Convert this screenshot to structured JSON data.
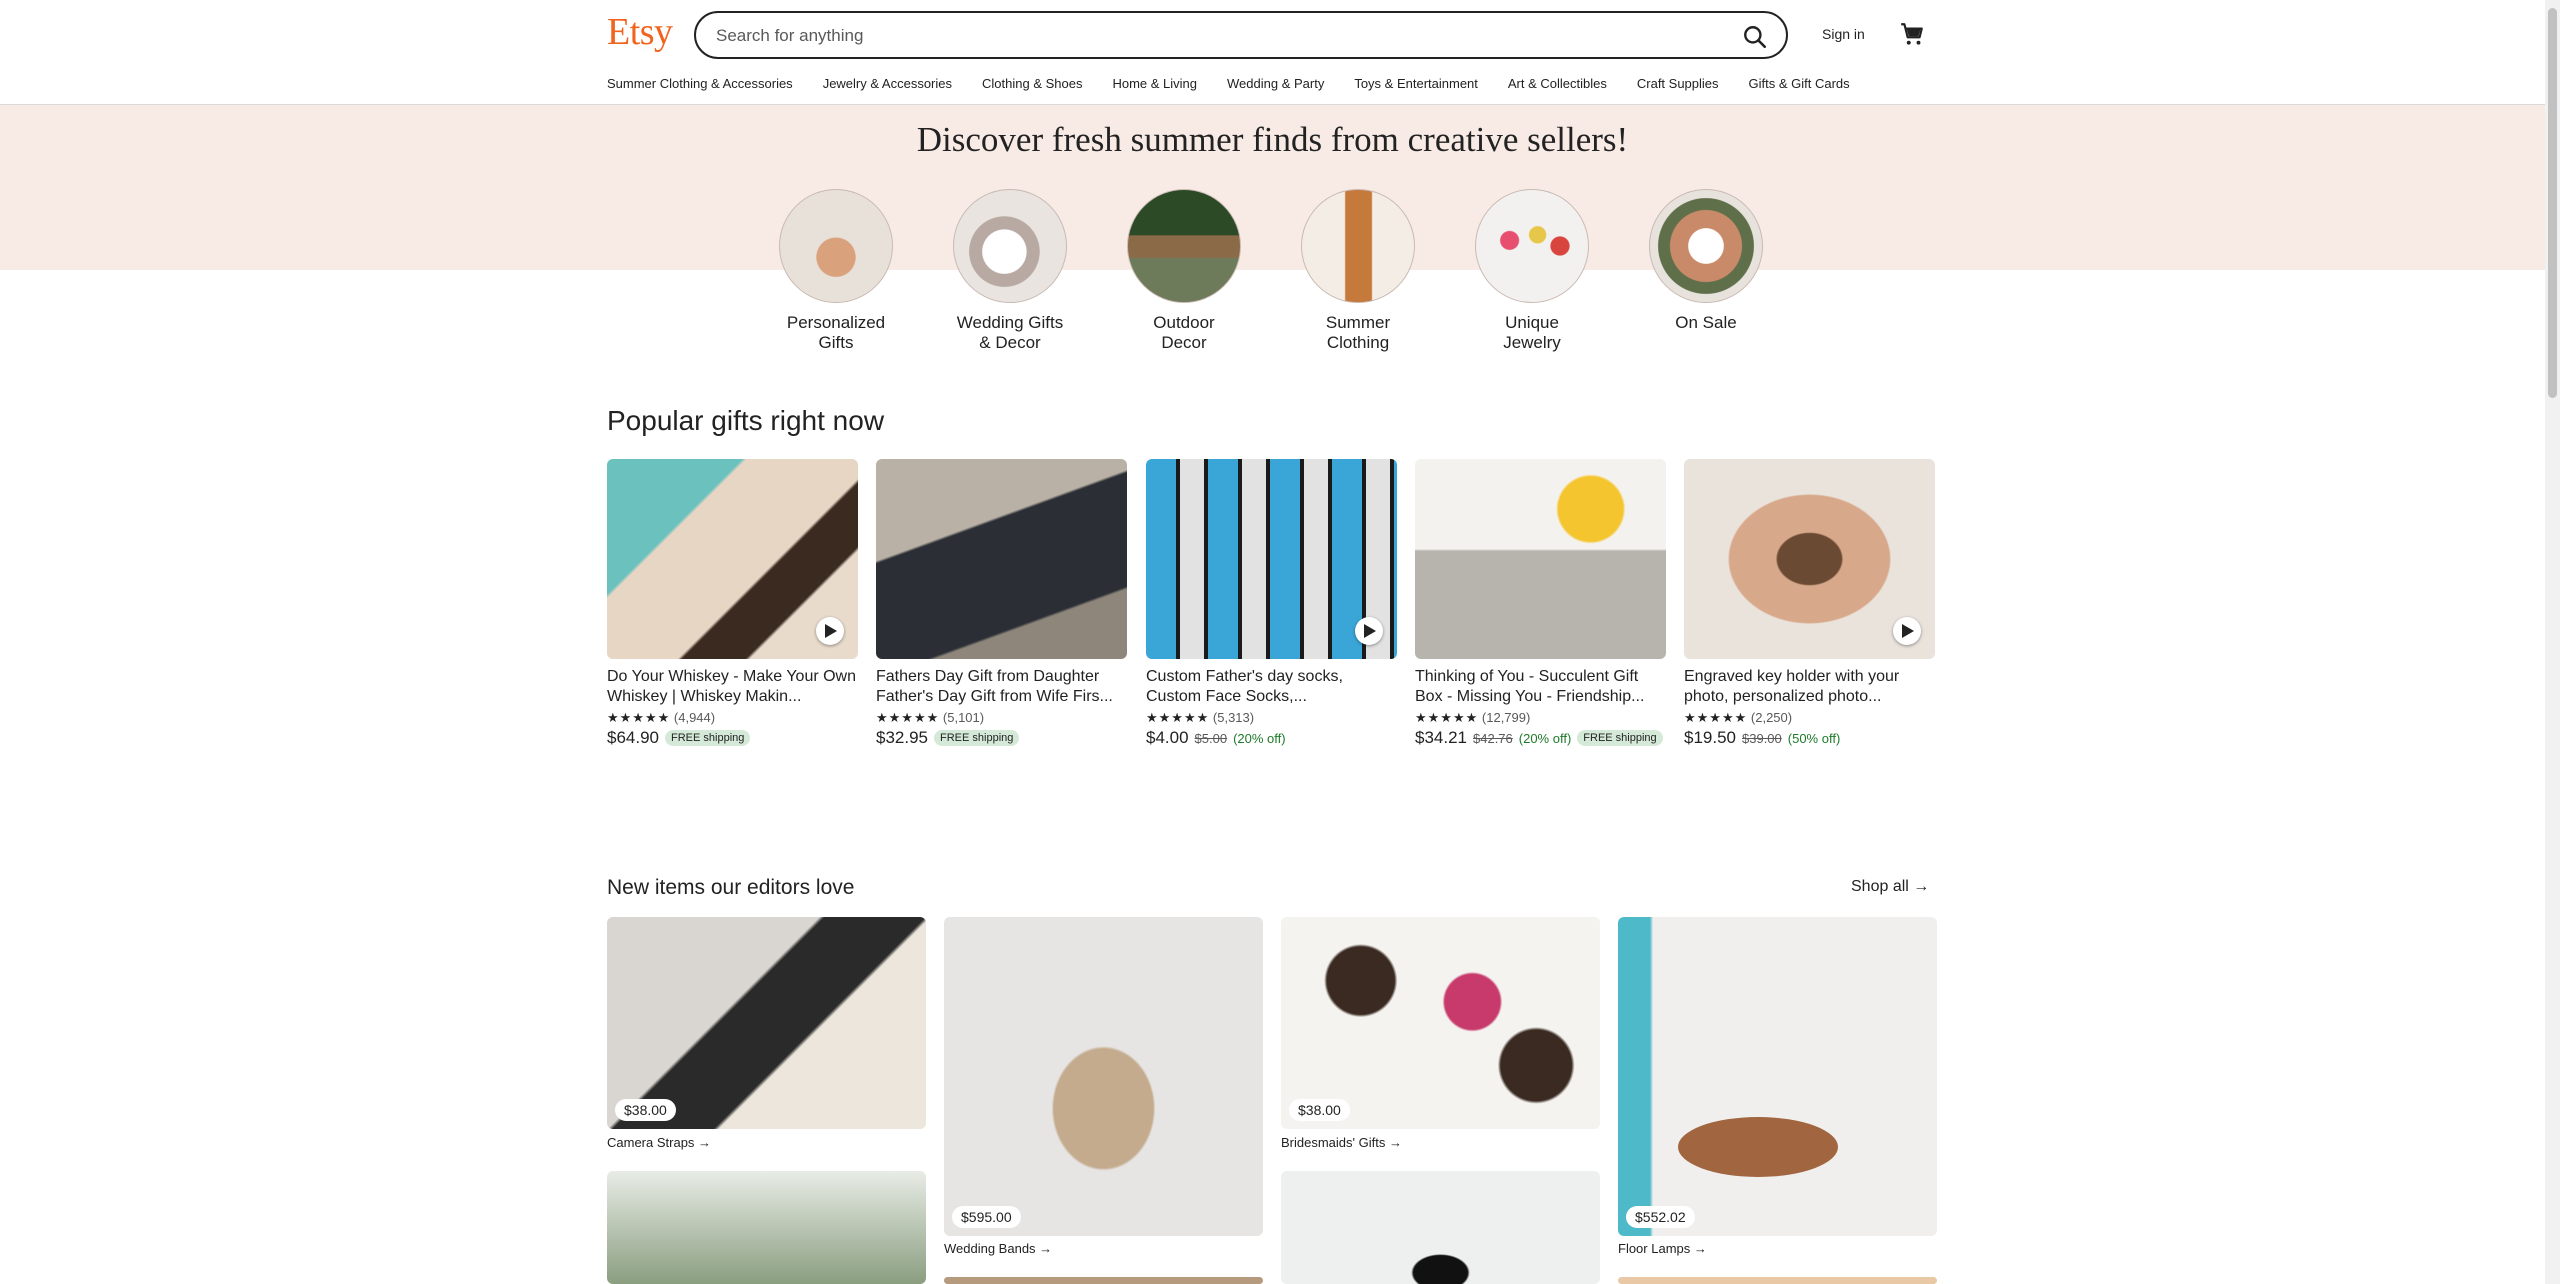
{
  "header": {
    "logo": "Etsy",
    "search_placeholder": "Search for anything",
    "sign_in": "Sign in"
  },
  "nav": [
    "Summer Clothing & Accessories",
    "Jewelry & Accessories",
    "Clothing & Shoes",
    "Home & Living",
    "Wedding & Party",
    "Toys & Entertainment",
    "Art & Collectibles",
    "Craft Supplies",
    "Gifts & Gift Cards"
  ],
  "hero": {
    "title": "Discover fresh summer finds from creative sellers!",
    "categories": [
      {
        "line1": "Personalized",
        "line2": "Gifts"
      },
      {
        "line1": "Wedding Gifts",
        "line2": "& Decor"
      },
      {
        "line1": "Outdoor",
        "line2": "Decor"
      },
      {
        "line1": "Summer",
        "line2": "Clothing"
      },
      {
        "line1": "Unique",
        "line2": "Jewelry"
      },
      {
        "line1": "On Sale",
        "line2": ""
      }
    ]
  },
  "popular": {
    "title": "Popular gifts right now",
    "items": [
      {
        "title": "Do Your Whiskey - Make Your Own Whiskey | Whiskey Makin...",
        "stars": "★★★★★",
        "reviews": "(4,944)",
        "price": "$64.90",
        "original": "",
        "discount": "",
        "free": "FREE shipping"
      },
      {
        "title": "Fathers Day Gift from Daughter Father's Day Gift from Wife Firs...",
        "stars": "★★★★★",
        "reviews": "(5,101)",
        "price": "$32.95",
        "original": "",
        "discount": "",
        "free": "FREE shipping"
      },
      {
        "title": "Custom Father's day socks, Custom Face Socks,...",
        "stars": "★★★★★",
        "reviews": "(5,313)",
        "price": "$4.00",
        "original": "$5.00",
        "discount": "(20% off)",
        "free": ""
      },
      {
        "title": "Thinking of You - Succulent Gift Box - Missing You - Friendship...",
        "stars": "★★★★★",
        "reviews": "(12,799)",
        "price": "$34.21",
        "original": "$42.76",
        "discount": "(20% off)",
        "free": "FREE shipping"
      },
      {
        "title": "Engraved key holder with your photo, personalized photo...",
        "stars": "★★★★★",
        "reviews": "(2,250)",
        "price": "$19.50",
        "original": "$39.00",
        "discount": "(50% off)",
        "free": ""
      }
    ]
  },
  "editors": {
    "title": "New items our editors love",
    "shop_all": "Shop all",
    "items": [
      {
        "price": "$38.00",
        "caption": "Camera Straps"
      },
      {
        "price": "$595.00",
        "caption": "Wedding Bands"
      },
      {
        "price": "$38.00",
        "caption": "Bridesmaids' Gifts"
      },
      {
        "price": "$552.02",
        "caption": "Floor Lamps"
      }
    ]
  },
  "colors": {
    "brand": "#f1641e",
    "hero_bg": "#f8ebe6",
    "free_badge": "#d4e9d7",
    "discount": "#1f7a2a"
  }
}
